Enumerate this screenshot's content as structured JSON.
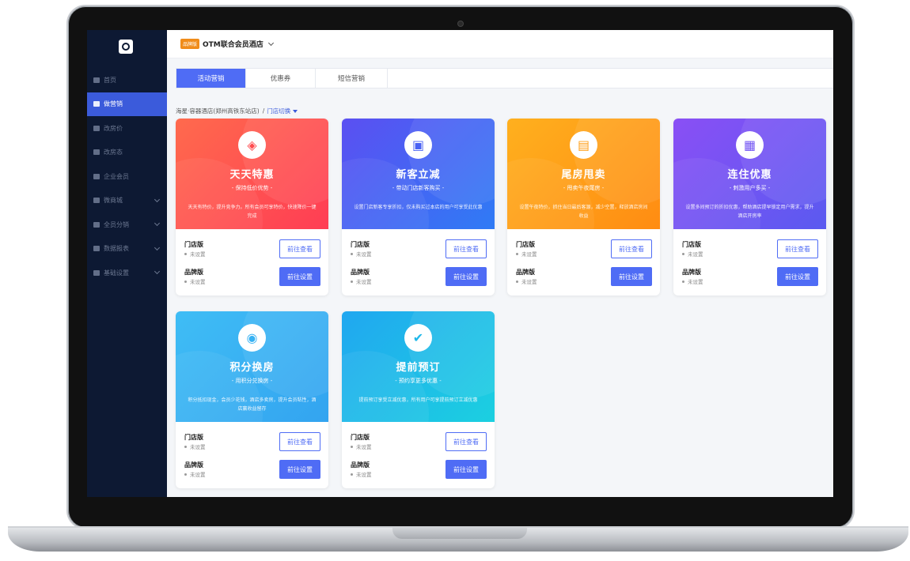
{
  "app": {
    "hotel_badge": "品牌版",
    "hotel_name": "OTM联合会员酒店"
  },
  "sidebar": {
    "items": [
      {
        "label": "首页",
        "icon": "home-icon",
        "active": false,
        "expandable": false
      },
      {
        "label": "做营销",
        "icon": "marketing-icon",
        "active": true,
        "expandable": false
      },
      {
        "label": "改房价",
        "icon": "price-icon",
        "active": false,
        "expandable": false
      },
      {
        "label": "改房态",
        "icon": "room-status-icon",
        "active": false,
        "expandable": false
      },
      {
        "label": "企业会员",
        "icon": "enterprise-icon",
        "active": false,
        "expandable": false
      },
      {
        "label": "微商城",
        "icon": "shop-icon",
        "active": false,
        "expandable": true
      },
      {
        "label": "全员分销",
        "icon": "distribution-icon",
        "active": false,
        "expandable": true
      },
      {
        "label": "数据报表",
        "icon": "report-icon",
        "active": false,
        "expandable": true
      },
      {
        "label": "基础设置",
        "icon": "settings-icon",
        "active": false,
        "expandable": true
      }
    ]
  },
  "tabs": [
    "活动营销",
    "优惠券",
    "短信营销"
  ],
  "breadcrumb": {
    "store": "海星·容器酒店(郑州高铁东站店)",
    "separator": "/",
    "switch_label": "门店切换"
  },
  "labels": {
    "store_edition": "门店版",
    "brand_edition": "品牌版",
    "not_set": "未设置",
    "view_button": "前往查看",
    "setup_button": "前往设置"
  },
  "cards": [
    {
      "title": "天天特惠",
      "subtitle": "- 保持低价优势 -",
      "desc": "天天有特价，提升竞争力。所有会员可享特价，快速降价一键完成",
      "icon": "tag-icon",
      "color": "#ff4d50"
    },
    {
      "title": "新客立减",
      "subtitle": "- 带动门店新客购买 -",
      "desc": "设置门店新客专享折扣，仅未购买过本店的用户可享受此优惠",
      "icon": "gift-icon",
      "color": "#4a62f3"
    },
    {
      "title": "尾房甩卖",
      "subtitle": "- 甩卖午夜尾房 -",
      "desc": "设置午夜特价，抓住当日最后客源，减少空置，释放酒店房间收益",
      "icon": "bed-icon",
      "color": "#ff9f18"
    },
    {
      "title": "连住优惠",
      "subtitle": "- 刺激用户多买 -",
      "desc": "设置多间预订的折扣优惠，帮助酒店提早锁定用户需求，提升酒店开房率",
      "icon": "calendar-icon",
      "color": "#7153f3"
    },
    {
      "title": "积分换房",
      "subtitle": "- 用积分兑换房 -",
      "desc": "积分抵扣现金，会员少花钱，酒店多卖房，提升会员粘性，酒店赢收益留存",
      "icon": "points-icon",
      "color": "#38b2f3"
    },
    {
      "title": "提前预订",
      "subtitle": "- 预约享更多优惠 -",
      "desc": "提前预订享受立减优惠，所有用户可享提前预订立减优惠",
      "icon": "check-icon",
      "color": "#1fb8ea"
    }
  ]
}
